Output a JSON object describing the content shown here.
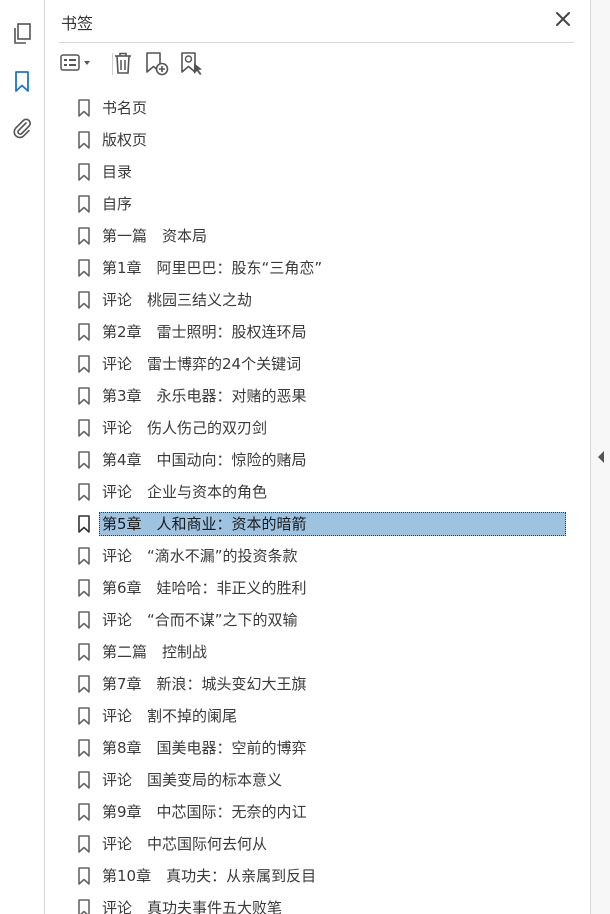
{
  "rail": {
    "items": [
      {
        "name": "pages-icon"
      },
      {
        "name": "bookmarks-icon",
        "active": true
      },
      {
        "name": "attachments-icon"
      }
    ],
    "accent": "#1a73d9"
  },
  "panel": {
    "title": "书签",
    "toolbar": {
      "options_icon": "list-options-icon",
      "delete_icon": "trash-icon",
      "new_bookmark_icon": "new-bookmark-icon",
      "find_bookmark_icon": "find-bookmark-icon"
    }
  },
  "bookmarks": [
    {
      "label": "书名页"
    },
    {
      "label": "版权页"
    },
    {
      "label": "目录"
    },
    {
      "label": "自序"
    },
    {
      "label": "第一篇　资本局"
    },
    {
      "label": "第1章　阿里巴巴：股东“三角恋”"
    },
    {
      "label": "评论　桃园三结义之劫"
    },
    {
      "label": "第2章　雷士照明：股权连环局"
    },
    {
      "label": "评论　雷士博弈的24个关键词"
    },
    {
      "label": "第3章　永乐电器：对赌的恶果"
    },
    {
      "label": "评论　伤人伤己的双刃剑"
    },
    {
      "label": "第4章　中国动向：惊险的赌局"
    },
    {
      "label": "评论　企业与资本的角色"
    },
    {
      "label": "第5章　人和商业：资本的暗箭",
      "selected": true
    },
    {
      "label": "评论　“滴水不漏”的投资条款"
    },
    {
      "label": "第6章　娃哈哈：非正义的胜利"
    },
    {
      "label": "评论　“合而不谋”之下的双输"
    },
    {
      "label": "第二篇　控制战"
    },
    {
      "label": "第7章　新浪：城头变幻大王旗"
    },
    {
      "label": "评论　割不掉的阑尾"
    },
    {
      "label": "第8章　国美电器：空前的博弈"
    },
    {
      "label": "评论　国美变局的标本意义"
    },
    {
      "label": "第9章　中芯国际：无奈的内讧"
    },
    {
      "label": "评论　中芯国际何去何从"
    },
    {
      "label": "第10章　真功夫：从亲属到反目"
    },
    {
      "label": "评论　真功夫事件五大败笔"
    }
  ],
  "colors": {
    "selection": "#9ec3e0",
    "icon": "#555555"
  }
}
